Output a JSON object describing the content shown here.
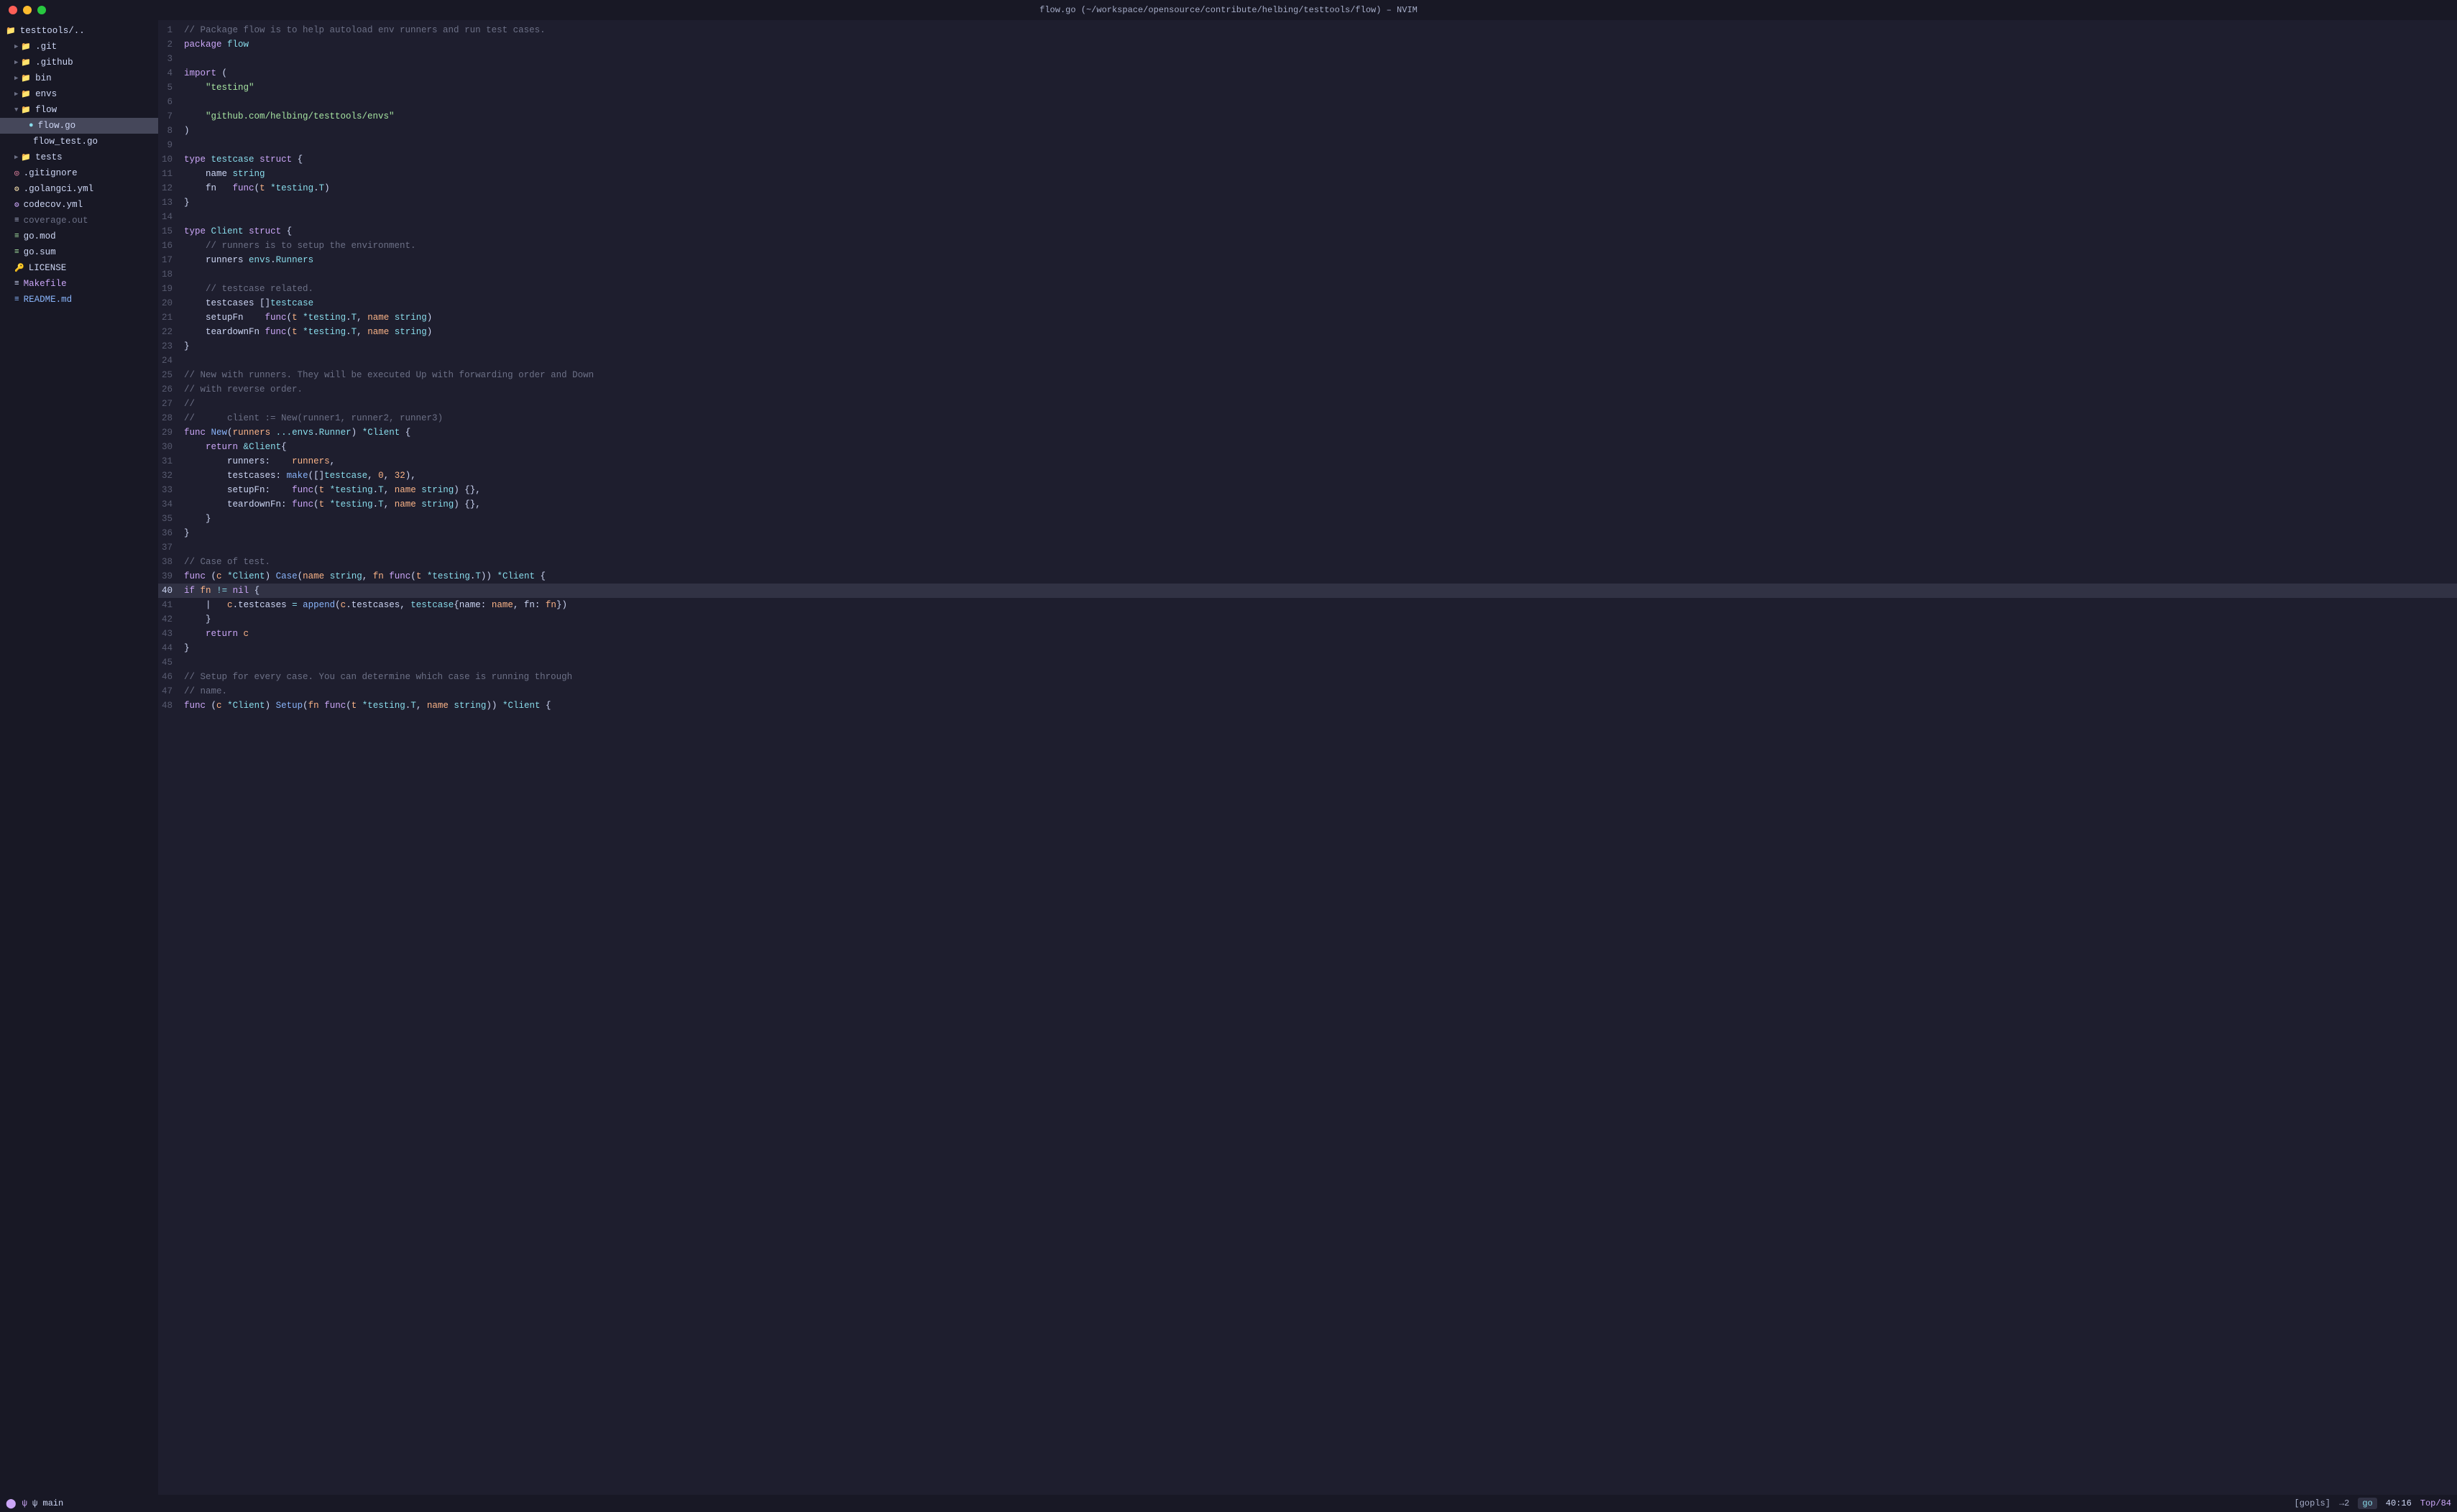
{
  "titlebar": {
    "title": "flow.go (~/workspace/opensource/contribute/helbing/testtools/flow) – NVIM"
  },
  "sidebar": {
    "root": "testtools/..",
    "items": [
      {
        "id": "git",
        "label": ".git",
        "type": "folder",
        "indent": 1,
        "expanded": false,
        "icon": "▶",
        "color": "git-color"
      },
      {
        "id": "github",
        "label": ".github",
        "type": "folder",
        "indent": 1,
        "expanded": false,
        "icon": "▶",
        "color": "github-color"
      },
      {
        "id": "bin",
        "label": "bin",
        "type": "folder",
        "indent": 1,
        "expanded": false,
        "icon": "▶",
        "color": "bin-color"
      },
      {
        "id": "envs",
        "label": "envs",
        "type": "folder",
        "indent": 1,
        "expanded": false,
        "icon": "▶",
        "color": "envs-color"
      },
      {
        "id": "flow",
        "label": "flow",
        "type": "folder",
        "indent": 1,
        "expanded": true,
        "icon": "▼",
        "color": "flow-color"
      },
      {
        "id": "flow.go",
        "label": "flow.go",
        "type": "file",
        "indent": 2,
        "icon": "●",
        "color": "go-color",
        "active": true
      },
      {
        "id": "flow_test.go",
        "label": "flow_test.go",
        "type": "file",
        "indent": 2,
        "icon": " ",
        "color": "test-color"
      },
      {
        "id": "tests",
        "label": "tests",
        "type": "folder",
        "indent": 1,
        "expanded": false,
        "icon": "▶",
        "color": "tests-color"
      },
      {
        "id": "gitignore",
        "label": ".gitignore",
        "type": "file",
        "indent": 1,
        "icon": "◎",
        "color": "gitignore-color"
      },
      {
        "id": "golangci",
        "label": ".golangci.yml",
        "type": "file",
        "indent": 1,
        "icon": "⚙",
        "color": "golangci-color"
      },
      {
        "id": "codecov",
        "label": "codecov.yml",
        "type": "file",
        "indent": 1,
        "icon": "⚙",
        "color": "codecov-color"
      },
      {
        "id": "coverage",
        "label": "coverage.out",
        "type": "file",
        "indent": 1,
        "icon": "≡",
        "color": "coverage-color"
      },
      {
        "id": "gomod",
        "label": "go.mod",
        "type": "file",
        "indent": 1,
        "icon": "≡",
        "color": "gomod-color"
      },
      {
        "id": "gosum",
        "label": "go.sum",
        "type": "file",
        "indent": 1,
        "icon": "≡",
        "color": "gosum-color"
      },
      {
        "id": "license",
        "label": "LICENSE",
        "type": "file",
        "indent": 1,
        "icon": "🔑",
        "color": "license-color"
      },
      {
        "id": "makefile",
        "label": "Makefile",
        "type": "file",
        "indent": 1,
        "icon": "≡",
        "color": "makefile-color"
      },
      {
        "id": "readme",
        "label": "README.md",
        "type": "file",
        "indent": 1,
        "icon": "≡",
        "color": "readme-color"
      }
    ]
  },
  "statusbar": {
    "icon": "⬤",
    "mode": "ψ main",
    "gopls": "[gopls]",
    "lsp_status": "→2",
    "go_badge": "go",
    "position": "40:16",
    "top": "Top/84"
  }
}
